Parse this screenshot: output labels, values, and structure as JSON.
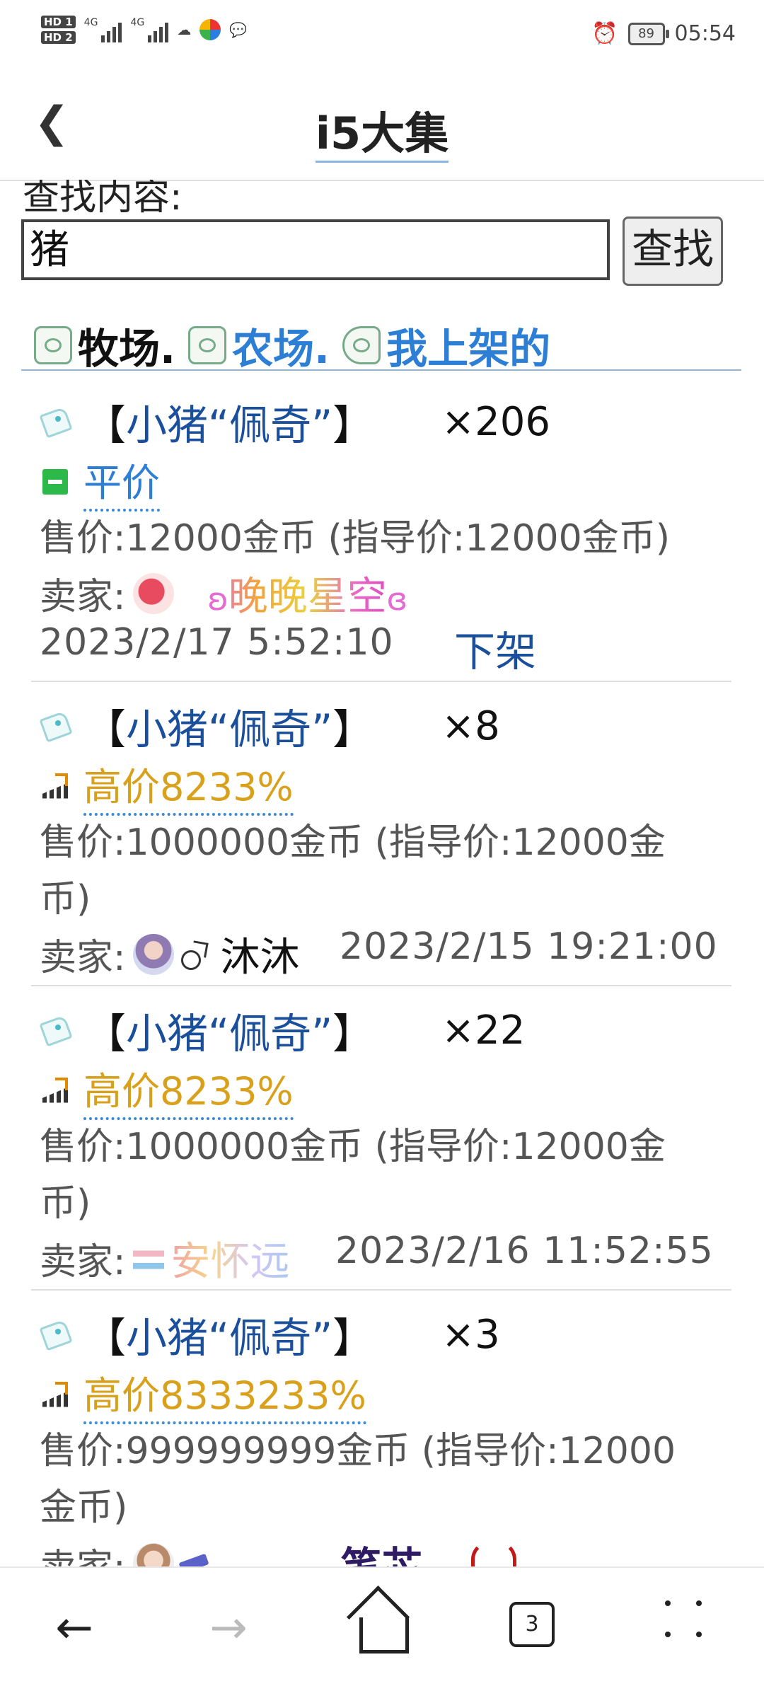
{
  "status_bar": {
    "hd1": "HD 1",
    "hd2": "HD 2",
    "net1": "4G",
    "net2": "4G",
    "battery": "89",
    "time": "05:54"
  },
  "header": {
    "back_icon": "chevron-left-icon",
    "title": "i5大集"
  },
  "search": {
    "label": "查找内容:",
    "value": "猪",
    "button": "查找"
  },
  "tabs": [
    {
      "label": "牧场.",
      "icon": "barn-icon",
      "active": true
    },
    {
      "label": "农场.",
      "icon": "farm-icon",
      "active": false
    },
    {
      "label": "我上架的",
      "icon": "cart-icon",
      "active": false
    }
  ],
  "listings": [
    {
      "bracket_open": "【",
      "name": "小猪“佩奇”",
      "bracket_close": "】",
      "qty": "×206",
      "price_tag": "平价",
      "price_line": "售价:12000金币 (指导价:12000金币)",
      "seller_label": "卖家:",
      "seller": "晚晚星空",
      "time": "2023/2/17 5:52:10",
      "action": "下架"
    },
    {
      "bracket_open": "【",
      "name": "小猪“佩奇”",
      "bracket_close": "】",
      "qty": "×8",
      "price_tag": "高价8233%",
      "price_line1": "售价:1000000金币 (指导价:12000金",
      "price_line2": "币)",
      "seller_label": "卖家:",
      "seller": "沐沐",
      "time": "2023/2/15 19:21:00"
    },
    {
      "bracket_open": "【",
      "name": "小猪“佩奇”",
      "bracket_close": "】",
      "qty": "×22",
      "price_tag": "高价8233%",
      "price_line1": "售价:1000000金币 (指导价:12000金",
      "price_line2": "币)",
      "seller_label": "卖家:",
      "seller": "安怀远",
      "time": "2023/2/16 11:52:55"
    },
    {
      "bracket_open": "【",
      "name": "小猪“佩奇”",
      "bracket_close": "】",
      "qty": "×3",
      "price_tag": "高价8333233%",
      "price_line1": "售价:999999999金币 (指导价:12000",
      "price_line2": "金币)",
      "seller_label": "卖家:",
      "seller": "笔芯."
    }
  ],
  "bottom_nav": {
    "tab_count": "3"
  },
  "colors": {
    "link_blue": "#1a4f9c",
    "high_price": "#d9a11b",
    "flat_price": "#2c7fd4",
    "flat_badge": "#2db84a"
  }
}
